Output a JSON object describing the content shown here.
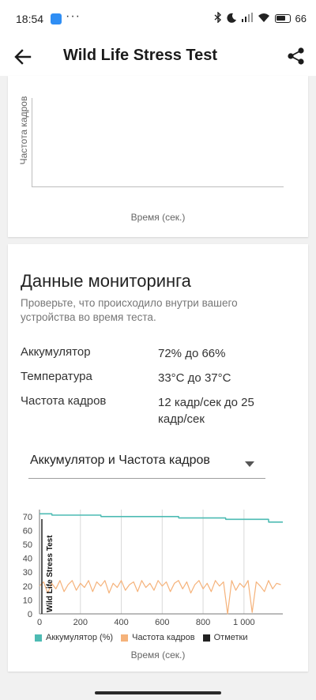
{
  "status_bar": {
    "time": "18:54",
    "dots": "···",
    "battery": "66"
  },
  "app_bar": {
    "title": "Wild Life Stress Test"
  },
  "fps_card": {
    "ylabel": "Частота кадров",
    "xlabel": "Время (сек.)"
  },
  "monitoring": {
    "title": "Данные мониторинга",
    "subtitle": "Проверьте, что происходило внутри вашего устройства во время теста.",
    "rows": [
      {
        "label": "Аккумулятор",
        "value": "72% до 66%"
      },
      {
        "label": "Температура",
        "value": "33°C до 37°C"
      },
      {
        "label": "Частота кадров",
        "value": "12 кадр/сек до 25 кадр/сек"
      }
    ],
    "dropdown": "Аккумулятор и Частота кадров"
  },
  "colors": {
    "battery": "#4dbbb3",
    "fps": "#f5b27a",
    "markers": "#222222"
  },
  "chart_data": {
    "type": "line",
    "xlabel": "Время (сек.)",
    "x_ticks": [
      "0",
      "200",
      "400",
      "600",
      "800",
      "1 000"
    ],
    "y_ticks": [
      "0",
      "10",
      "20",
      "30",
      "40",
      "50",
      "60",
      "70"
    ],
    "xlim": [
      0,
      1190
    ],
    "ylim": [
      0,
      75
    ],
    "grid": "vertical",
    "legend_position": "bottom",
    "annotation": "Wild Life Stress Test",
    "series": [
      {
        "name": "Аккумулятор (%)",
        "x": [
          0,
          60,
          61,
          300,
          301,
          680,
          681,
          910,
          911,
          1120,
          1121,
          1190
        ],
        "y": [
          72,
          72,
          71,
          71,
          70,
          70,
          69,
          69,
          68,
          68,
          66,
          66
        ]
      },
      {
        "name": "Частота кадров",
        "x": [
          0,
          20,
          40,
          60,
          80,
          100,
          120,
          140,
          160,
          180,
          200,
          220,
          240,
          260,
          280,
          300,
          320,
          340,
          360,
          380,
          400,
          420,
          440,
          460,
          480,
          500,
          520,
          540,
          560,
          580,
          600,
          620,
          640,
          660,
          680,
          700,
          720,
          740,
          760,
          780,
          800,
          820,
          840,
          860,
          880,
          900,
          920,
          940,
          960,
          980,
          1000,
          1020,
          1040,
          1060,
          1080,
          1100,
          1120,
          1140,
          1160,
          1180
        ],
        "y": [
          20,
          23,
          15,
          22,
          18,
          24,
          16,
          21,
          24,
          17,
          22,
          19,
          24,
          16,
          23,
          20,
          24,
          15,
          22,
          19,
          24,
          17,
          21,
          23,
          16,
          24,
          19,
          22,
          17,
          24,
          20,
          23,
          16,
          22,
          24,
          18,
          23,
          15,
          21,
          24,
          18,
          22,
          16,
          24,
          20,
          23,
          0,
          24,
          17,
          22,
          19,
          24,
          1,
          23,
          20,
          16,
          24,
          18,
          22,
          21
        ]
      },
      {
        "name": "Отметки",
        "x": [],
        "y": []
      }
    ]
  }
}
